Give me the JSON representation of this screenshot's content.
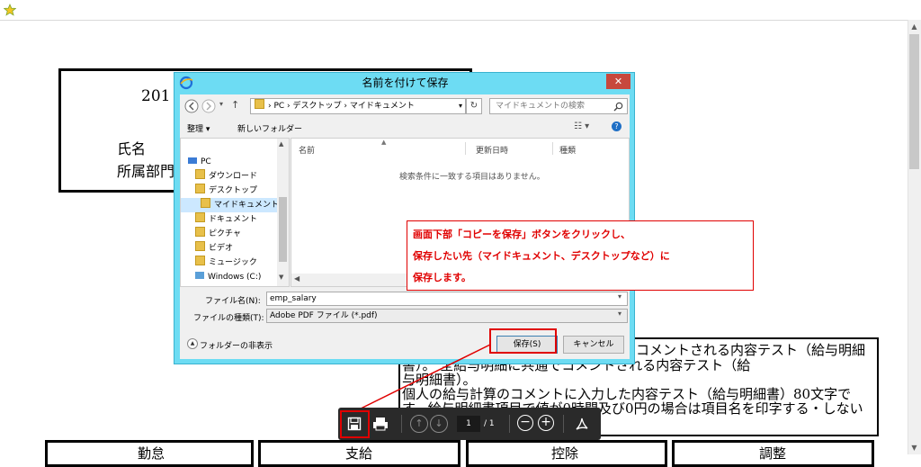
{
  "top_bar": {
    "favorite_icon": "star-icon"
  },
  "pdf": {
    "header_title_partial": "201",
    "name_label": "氏名",
    "dept_label_partial": "所属部門",
    "comment_lines": [
      "コメントされる内容テスト（給与明細",
      "書）。 全給与明細に共通でコメントされる内容テスト（給",
      "与明細書）。",
      "個人の給与計算のコメントに入力した内容テスト（給与明細書）80文字で",
      "す。給与明細書項目で値が0時間及び0円の場合は項目名を印字する・しない"
    ],
    "bottom_headers": [
      "勤怠",
      "支給",
      "控除",
      "調整"
    ]
  },
  "dialog": {
    "title": "名前を付けて保存",
    "close_label": "✕",
    "breadcrumb": [
      "PC",
      "デスクトップ",
      "マイドキュメント"
    ],
    "search_placeholder": "マイドキュメントの検索",
    "organize_label": "整理 ▾",
    "new_folder_label": "新しいフォルダー",
    "nav_items": [
      {
        "label": "PC",
        "icon": "pc-icon"
      },
      {
        "label": "ダウンロード",
        "icon": "folder-icon"
      },
      {
        "label": "デスクトップ",
        "icon": "folder-icon"
      },
      {
        "label": "マイドキュメント",
        "icon": "folder-icon"
      },
      {
        "label": "ドキュメント",
        "icon": "folder-icon"
      },
      {
        "label": "ピクチャ",
        "icon": "folder-icon"
      },
      {
        "label": "ビデオ",
        "icon": "folder-icon"
      },
      {
        "label": "ミュージック",
        "icon": "folder-icon"
      },
      {
        "label": "Windows (C:)",
        "icon": "drive-icon"
      }
    ],
    "columns": [
      "名前",
      "更新日時",
      "種類"
    ],
    "empty_message": "検索条件に一致する項目はありません。",
    "filename_label": "ファイル名(N):",
    "filename_value": "emp_salary",
    "filetype_label": "ファイルの種類(T):",
    "filetype_value": "Adobe PDF ファイル (*.pdf)",
    "hide_folders_label": "フォルダーの非表示",
    "save_label": "保存(S)",
    "cancel_label": "キャンセル"
  },
  "annotation": {
    "lines": [
      "画面下部「コピーを保存」ボタンをクリックし、",
      "保存したい先（マイドキュメント、デスクトップなど）に",
      "保存します。"
    ],
    "color": "#e00000"
  },
  "pdf_toolbar": {
    "page_current": "1",
    "page_total": "/ 1"
  }
}
